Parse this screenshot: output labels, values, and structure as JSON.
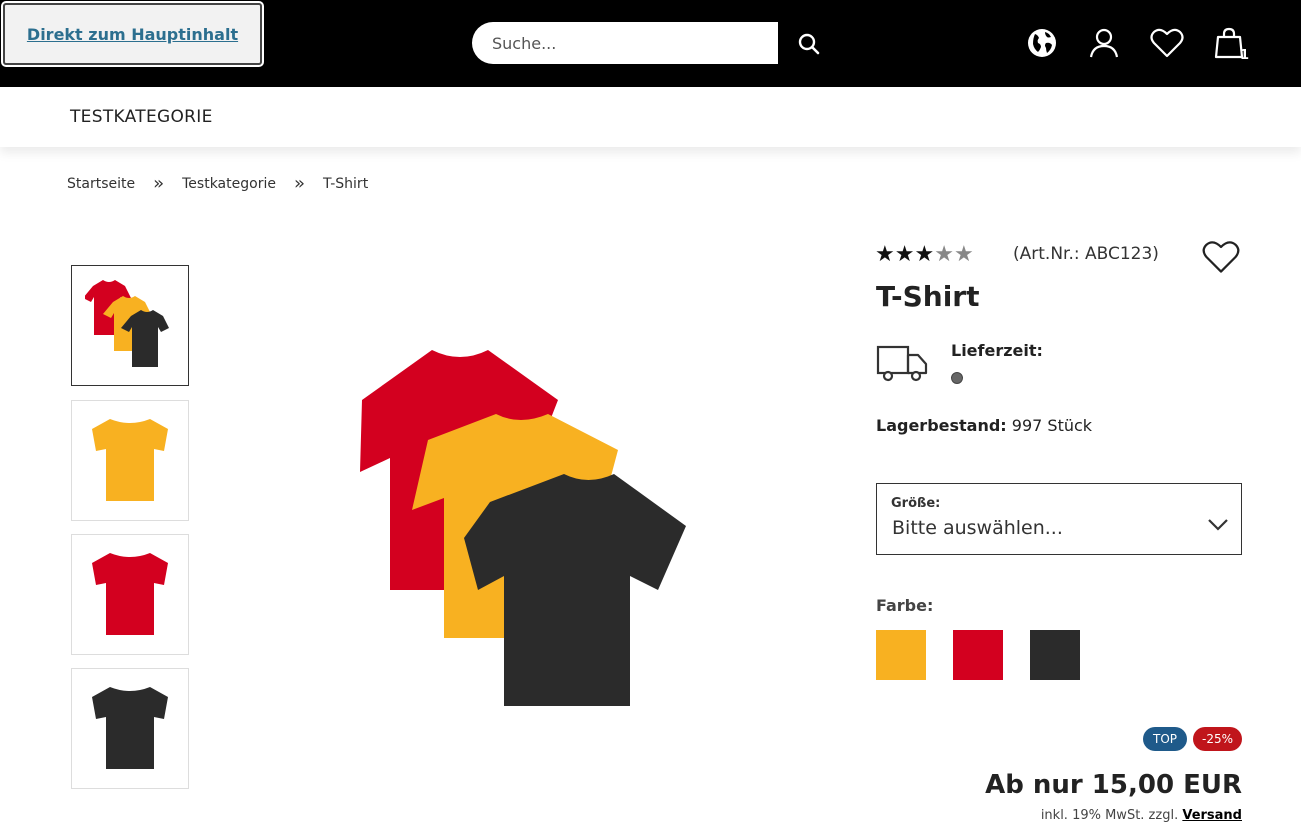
{
  "header": {
    "skip_link": "Direkt zum Hauptinhalt",
    "search_placeholder": "Suche...",
    "cart_count": "1"
  },
  "nav": {
    "category": "TESTKATEGORIE"
  },
  "breadcrumb": {
    "items": [
      "Startseite",
      "Testkategorie",
      "T-Shirt"
    ],
    "separator": "»"
  },
  "product": {
    "rating": 3,
    "rating_max": 5,
    "article_number": "(Art.Nr.: ABC123)",
    "title": "T-Shirt",
    "delivery_label": "Lieferzeit:",
    "stock_label": "Lagerbestand:",
    "stock_value": "997 Stück",
    "size": {
      "label": "Größe:",
      "value": "Bitte auswählen..."
    },
    "color_label": "Farbe:",
    "colors": [
      "#f8b121",
      "#d3001f",
      "#2b2b2b"
    ],
    "badges": {
      "top": "TOP",
      "discount": "-25%"
    },
    "price": "Ab nur 15,00 EUR",
    "tax_text": "inkl. 19% MwSt. zzgl.",
    "shipping_link": "Versand"
  },
  "colors": {
    "badge_top": "#1f5a8a",
    "badge_discount": "#c0151b",
    "header_bg": "#000000"
  }
}
